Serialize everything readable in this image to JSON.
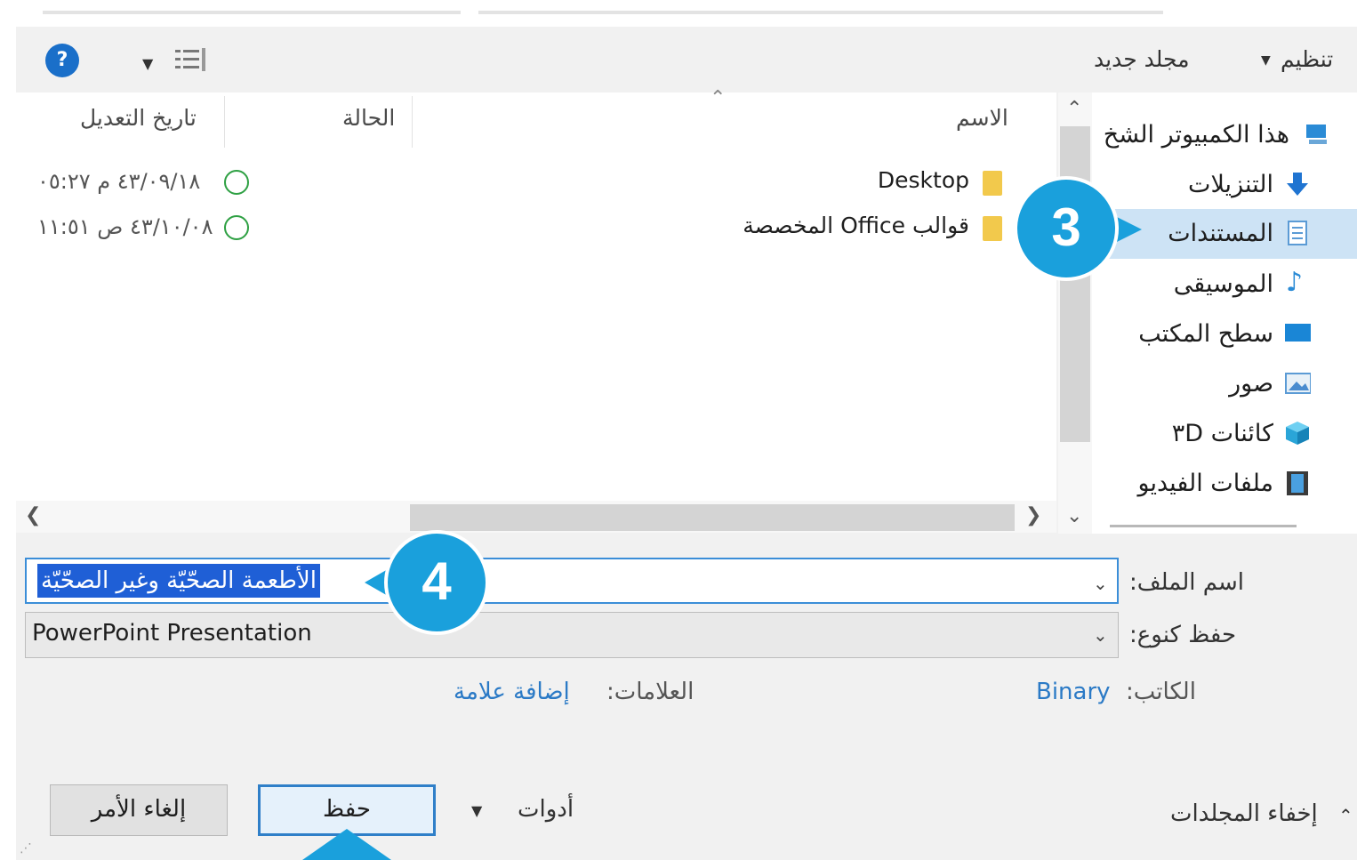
{
  "toolbar": {
    "organize_label": "تنظيم",
    "new_folder_label": "مجلد جديد",
    "help_label": "?"
  },
  "columns": {
    "name": "الاسم",
    "status": "الحالة",
    "modified": "تاريخ التعديل"
  },
  "files": [
    {
      "name": "Desktop",
      "date": "٤٣/٠٩/١٨ م ٠٥:٢٧"
    },
    {
      "name": "قوالب Office المخصصة",
      "date": "٤٣/١٠/٠٨ ص ١١:٥١"
    }
  ],
  "nav": {
    "items": [
      {
        "label": "هذا الكمبيوتر الشخ",
        "icon": "computer-icon"
      },
      {
        "label": "التنزيلات",
        "icon": "download-icon"
      },
      {
        "label": "المستندات",
        "icon": "documents-icon",
        "selected": true
      },
      {
        "label": "الموسيقى",
        "icon": "music-icon"
      },
      {
        "label": "سطح المكتب",
        "icon": "desktop-icon"
      },
      {
        "label": "صور",
        "icon": "pictures-icon"
      },
      {
        "label": "كائنات ٣D",
        "icon": "3d-objects-icon"
      },
      {
        "label": "ملفات الفيديو",
        "icon": "video-icon"
      }
    ]
  },
  "form": {
    "filename_label": "اسم الملف:",
    "filename_value": "الأطعمة الصحّيّة وغير الصحّيّة",
    "savetype_label": "حفظ كنوع:",
    "savetype_value": "PowerPoint Presentation",
    "author_label": "الكاتب:",
    "author_value": "Binary",
    "tags_label": "العلامات:",
    "tags_value": "إضافة علامة"
  },
  "footer": {
    "hide_folders_label": "إخفاء المجلدات",
    "tools_label": "أدوات",
    "save_label": "حفظ",
    "cancel_label": "إلغاء الأمر"
  },
  "callouts": {
    "step3": "3",
    "step4": "4"
  },
  "colors": {
    "accent": "#1aa0dc",
    "selection": "#1f5fd6",
    "link": "#2b7ac6",
    "check": "#2ea043"
  }
}
